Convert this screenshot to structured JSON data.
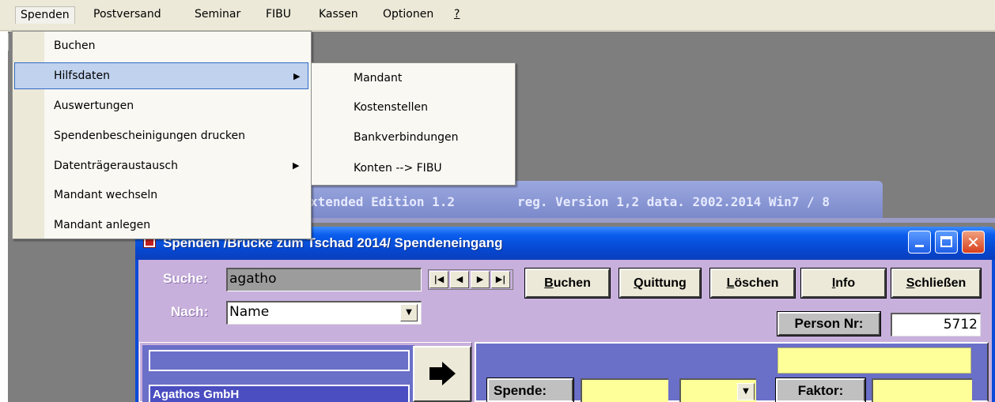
{
  "menubar": {
    "items": [
      "Spenden",
      "Postversand",
      "Seminar",
      "FIBU",
      "Kassen",
      "Optionen",
      "?"
    ]
  },
  "menu_spenden": {
    "items": [
      {
        "label": "Buchen",
        "submenu": false
      },
      {
        "label": "Hilfsdaten",
        "submenu": true,
        "highlighted": true
      },
      {
        "label": "Auswertungen",
        "submenu": false
      },
      {
        "label": "Spendenbescheinigungen drucken",
        "submenu": false
      },
      {
        "label": "Datenträgeraustausch",
        "submenu": true
      },
      {
        "label": "Mandant wechseln",
        "submenu": false
      },
      {
        "label": "Mandant anlegen",
        "submenu": false
      }
    ]
  },
  "menu_hilfsdaten": {
    "items": [
      "Mandant",
      "Kostenstellen",
      "Bankverbindungen",
      "Konten --> FIBU"
    ]
  },
  "banner": {
    "text_left": "xtended Edition 1.2",
    "text_right": "reg. Version 1,2 data. 2002.2014 Win7 / 8"
  },
  "window": {
    "title": "Spenden /Brücke zum Tschad 2014/ Spendeneingang",
    "icon": "app-icon"
  },
  "form": {
    "suche_label": "Suche:",
    "suche_value": "agatho",
    "nach_label": "Nach:",
    "nach_value": "Name",
    "nav_buttons": [
      "|◀",
      "◀",
      "▶",
      "▶|"
    ],
    "buttons": {
      "buchen": {
        "u": "B",
        "rest": "uchen"
      },
      "quittung": {
        "u": "Q",
        "rest": "uittung"
      },
      "loeschen": {
        "u": "L",
        "rest": "öschen"
      },
      "info": {
        "u": "I",
        "rest": "nfo"
      },
      "schliessen": {
        "u": "S",
        "rest": "chließen"
      }
    },
    "person_label": "Person Nr:",
    "person_value": "5712",
    "result_name": "Agathos GmbH",
    "spende_label": "Spende:",
    "faktor_label": "Faktor:"
  },
  "colors": {
    "titlebar": "#0647d0",
    "client": "#c8b0dd",
    "panel_blue": "#6a6fc8",
    "field_yellow": "#ffff99",
    "menu_highlight": "#c1d2ee"
  }
}
